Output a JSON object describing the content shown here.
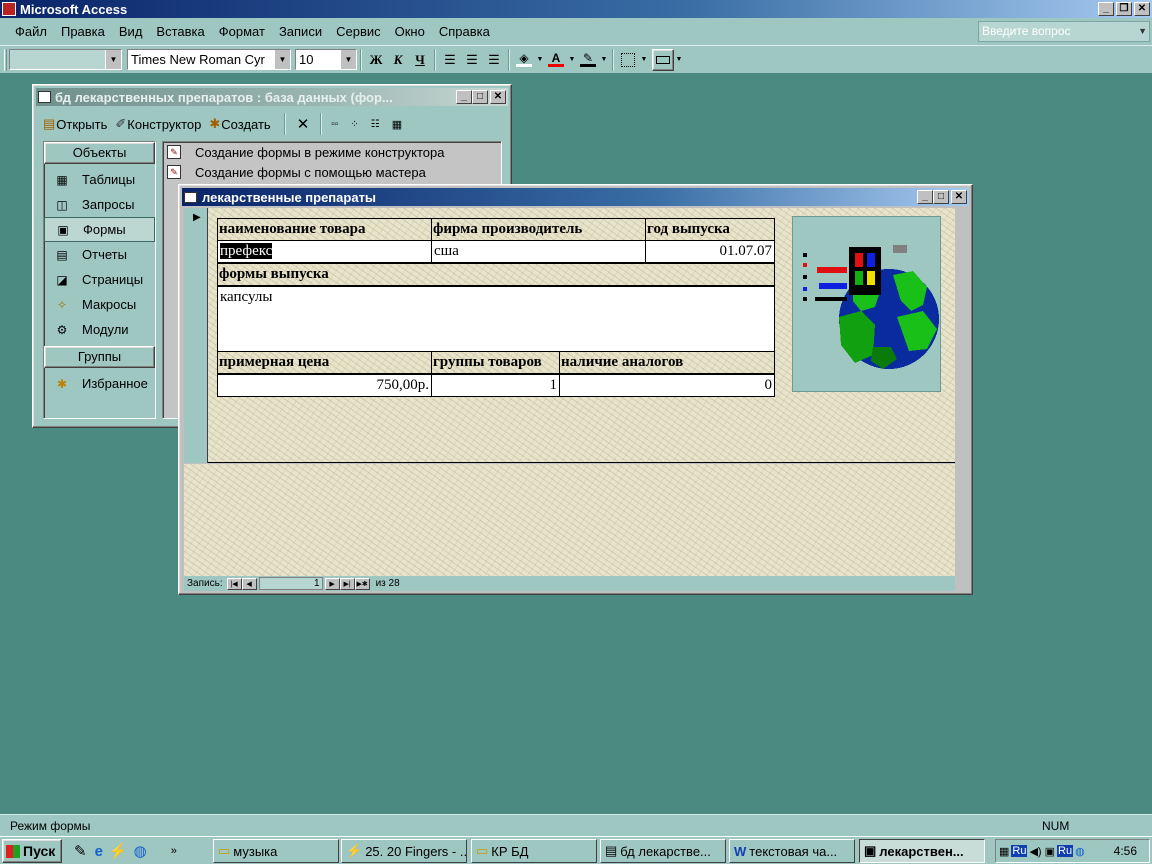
{
  "app": {
    "title": "Microsoft Access",
    "menu": [
      "Файл",
      "Правка",
      "Вид",
      "Вставка",
      "Формат",
      "Записи",
      "Сервис",
      "Окно",
      "Справка"
    ],
    "help_placeholder": "Введите вопрос"
  },
  "format_toolbar": {
    "object_combo": "",
    "font_name": "Times New Roman Cyr",
    "font_size": "10",
    "bold": "Ж",
    "italic": "К",
    "underline": "Ч"
  },
  "db_window": {
    "title": "бд лекарственных препаратов : база данных (фор...",
    "toolbar": {
      "open": "Открыть",
      "design": "Конструктор",
      "create": "Создать"
    },
    "objects_header": "Объекты",
    "objects": [
      "Таблицы",
      "Запросы",
      "Формы",
      "Отчеты",
      "Страницы",
      "Макросы",
      "Модули"
    ],
    "groups_header": "Группы",
    "groups": [
      "Избранное"
    ],
    "list": [
      "Создание формы в режиме конструктора",
      "Создание формы с помощью мастера"
    ]
  },
  "form_window": {
    "title": "лекарственные препараты",
    "labels": {
      "name": "наименование товара",
      "maker": "фирма производитель",
      "year": "год выпуска",
      "forms": "формы выпуска",
      "price": "примерная цена",
      "group": "группы товаров",
      "analogs": "наличие аналогов"
    },
    "values": {
      "name": "префекс",
      "maker": "сша",
      "year": "01.07.07",
      "forms": "капсулы",
      "price": "750,00р.",
      "group": "1",
      "analogs": "0"
    },
    "nav": {
      "label": "Запись:",
      "current": "1",
      "total_label": "из 28"
    }
  },
  "status": {
    "mode": "Режим формы",
    "num": "NUM"
  },
  "taskbar": {
    "start": "Пуск",
    "buttons": [
      "музыка",
      "25. 20 Fingers - ...",
      "КР БД",
      "бд лекарстве...",
      "текстовая ча...",
      "лекарствен..."
    ],
    "lang1": "Ru",
    "lang2": "Ru",
    "clock": "4:56"
  }
}
